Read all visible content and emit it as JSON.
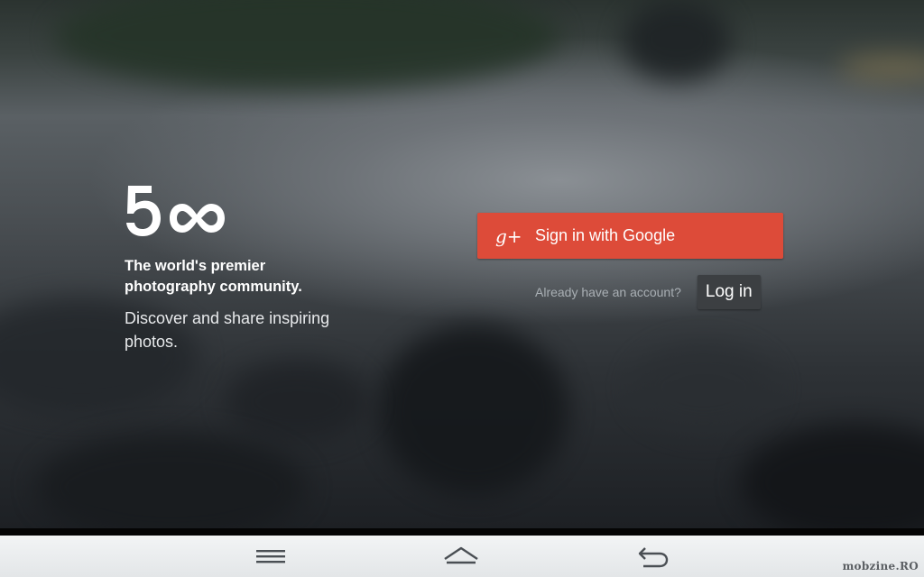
{
  "brand": {
    "logo_text": "500",
    "tagline_lines": [
      "The world's premier",
      "photography community."
    ],
    "description_lines": [
      "Discover and share inspiring",
      "photos."
    ]
  },
  "signin": {
    "google_icon": "google-plus-icon",
    "google_icon_text": "g+",
    "google_label": "Sign in with Google",
    "already_text": "Already have an account?",
    "login_label": "Log in"
  },
  "navbar": {
    "icons": [
      "menu-icon",
      "home-icon",
      "back-icon"
    ]
  },
  "watermark": "mobzine.RO",
  "colors": {
    "google_red": "#dd4b39",
    "login_bg": "#3c3f42",
    "navbar_bg": "#e9ecee"
  }
}
